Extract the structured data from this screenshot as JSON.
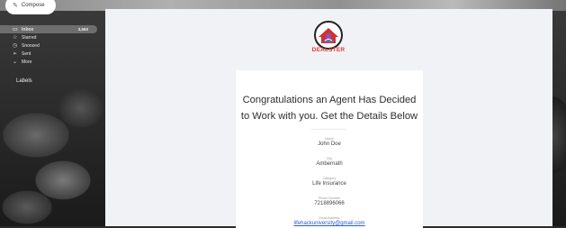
{
  "compose_label": "Compose",
  "nav": {
    "items": [
      {
        "label": "Inbox",
        "icon": "inbox-icon",
        "glyph": "▭",
        "count": "3,583"
      },
      {
        "label": "Starred",
        "icon": "star-icon",
        "glyph": "☆"
      },
      {
        "label": "Snoozed",
        "icon": "clock-icon",
        "glyph": "◷"
      },
      {
        "label": "Sent",
        "icon": "send-icon",
        "glyph": "➢"
      },
      {
        "label": "More",
        "icon": "chevron-down-icon",
        "glyph": "⌄"
      }
    ],
    "labels_header": "Labels"
  },
  "email": {
    "brand": "DEALSTER",
    "headline_line1": "Congratulations an Agent Has Decided",
    "headline_line2": "to Work with you. Get the Details Below",
    "fields": [
      {
        "label": "Name",
        "value": "John Doe"
      },
      {
        "label": "City",
        "value": "Ambernath"
      },
      {
        "label": "Category",
        "value": "Life Insurance"
      },
      {
        "label": "Phone Number",
        "value": "7218896066"
      },
      {
        "label": "Email Address",
        "value": "lifehackuniversity@gmail.com"
      }
    ]
  },
  "colors": {
    "brand_red": "#e53935",
    "link_blue": "#2a5bd7",
    "panel_bg": "#f1f2f6"
  }
}
